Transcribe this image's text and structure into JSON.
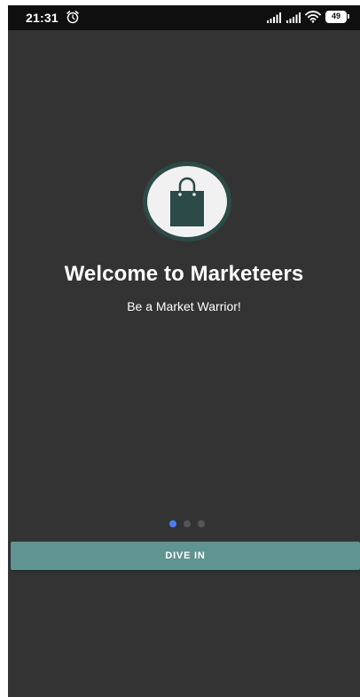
{
  "status_bar": {
    "time": "21:31",
    "battery": "49",
    "icons": [
      "alarm-icon",
      "signal-icon",
      "signal-icon",
      "wifi-icon",
      "battery-icon"
    ]
  },
  "onboarding": {
    "logo_icon": "shopping-bag-icon",
    "title": "Welcome to Marketeers",
    "subtitle": "Be a Market Warrior!",
    "pages_total": 3,
    "current_page": 1,
    "button_label": "DIVE IN"
  },
  "colors": {
    "background": "#333333",
    "status_bar": "#0f0f0f",
    "logo_dark": "#2c4a47",
    "logo_light": "#f1f1f1",
    "button": "#5f9490",
    "dot_active": "#4a7ef0",
    "dot_inactive": "#555555"
  }
}
